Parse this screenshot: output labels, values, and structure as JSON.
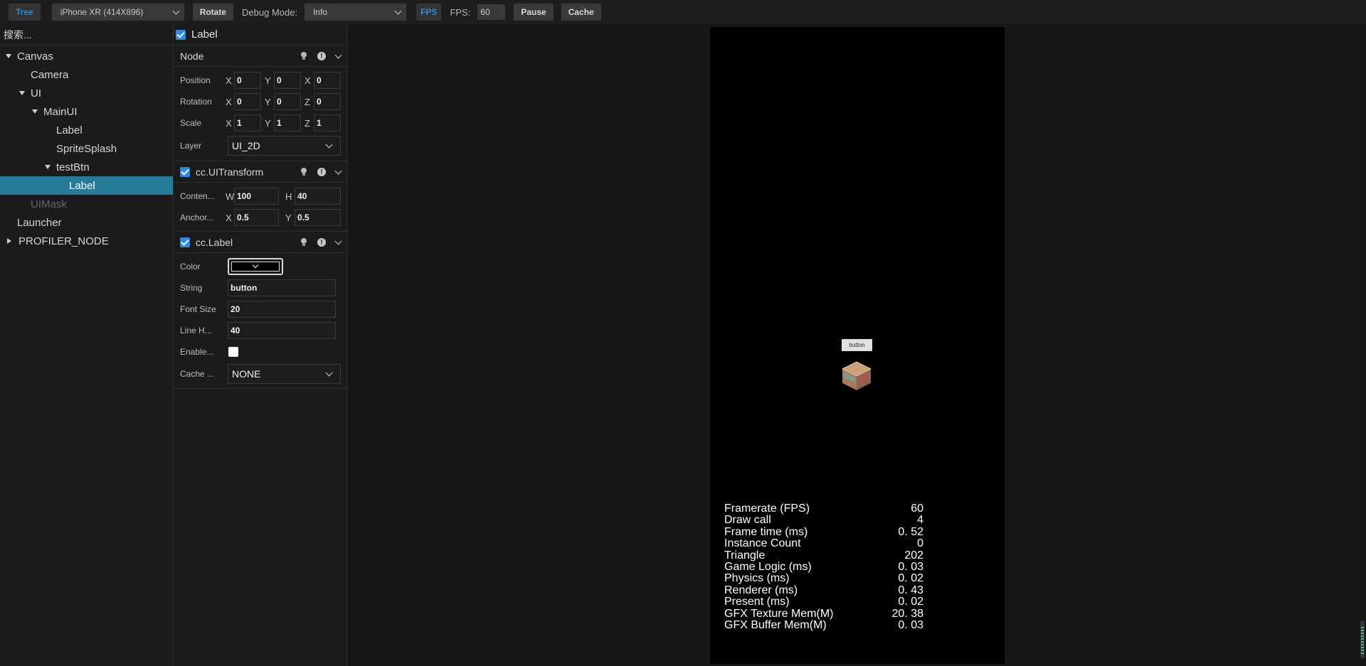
{
  "toolbar": {
    "tree_label": "Tree",
    "device_select": "iPhone XR (414X896)",
    "rotate_label": "Rotate",
    "debug_mode_label": "Debug Mode:",
    "debug_mode_value": "Info",
    "fps_toggle_label": "FPS",
    "fps_label": "FPS:",
    "fps_value": "60",
    "pause_label": "Pause",
    "cache_label": "Cache"
  },
  "tree": {
    "search_placeholder": "搜索...",
    "items": [
      {
        "label": "Canvas",
        "depth": 0,
        "expander": "down"
      },
      {
        "label": "Camera",
        "depth": 1,
        "expander": "none"
      },
      {
        "label": "UI",
        "depth": 1,
        "expander": "down"
      },
      {
        "label": "MainUI",
        "depth": 2,
        "expander": "down"
      },
      {
        "label": "Label",
        "depth": 3,
        "expander": "none"
      },
      {
        "label": "SpriteSplash",
        "depth": 3,
        "expander": "none"
      },
      {
        "label": "testBtn",
        "depth": 3,
        "expander": "down"
      },
      {
        "label": "Label",
        "depth": 4,
        "expander": "none",
        "selected": true
      },
      {
        "label": "UIMask",
        "depth": 1,
        "expander": "none",
        "muted": true
      },
      {
        "label": "Launcher",
        "depth": 0,
        "expander": "none"
      },
      {
        "label": "PROFILER_NODE",
        "depth": 0,
        "expander": "right"
      }
    ]
  },
  "inspector": {
    "node_name": "Label",
    "node_section": {
      "title": "Node",
      "position": {
        "label": "Position",
        "x": "0",
        "y": "0",
        "z_axis": "X",
        "z": "0"
      },
      "rotation": {
        "label": "Rotation",
        "x": "0",
        "y": "0",
        "z_axis": "Z",
        "z": "0"
      },
      "scale": {
        "label": "Scale",
        "x": "1",
        "y": "1",
        "z_axis": "Z",
        "z": "1"
      },
      "layer": {
        "label": "Layer",
        "value": "UI_2D"
      }
    },
    "uitransform_section": {
      "title": "cc.UITransform",
      "content_size": {
        "label": "Conten...",
        "w": "100",
        "h": "40"
      },
      "anchor": {
        "label": "Anchor...",
        "x": "0.5",
        "y": "0.5"
      }
    },
    "label_section": {
      "title": "cc.Label",
      "color_label": "Color",
      "color_value": "#000000",
      "string": {
        "label": "String",
        "value": "button"
      },
      "font_size": {
        "label": "Font Size",
        "value": "20"
      },
      "line_height": {
        "label": "Line H...",
        "value": "40"
      },
      "enable_label": "Enable...",
      "cache_mode": {
        "label": "Cache ...",
        "value": "NONE"
      }
    },
    "axis_x": "X",
    "axis_y": "Y",
    "axis_w": "W",
    "axis_h": "H"
  },
  "game": {
    "button_text": "button",
    "stats": [
      {
        "name": "Framerate (FPS)",
        "value": "60"
      },
      {
        "name": "Draw call",
        "value": "4"
      },
      {
        "name": "Frame time (ms)",
        "value": "0. 52"
      },
      {
        "name": "Instance Count",
        "value": "0"
      },
      {
        "name": "Triangle",
        "value": "202"
      },
      {
        "name": "Game Logic (ms)",
        "value": "0. 03"
      },
      {
        "name": "Physics (ms)",
        "value": "0. 02"
      },
      {
        "name": "Renderer (ms)",
        "value": "0. 43"
      },
      {
        "name": "Present (ms)",
        "value": "0. 02"
      },
      {
        "name": "GFX Texture Mem(M)",
        "value": "20. 38"
      },
      {
        "name": "GFX Buffer Mem(M)",
        "value": "0. 03"
      }
    ]
  },
  "colors": {
    "accent_blue": "#2e8be0",
    "selection": "#277b99"
  }
}
